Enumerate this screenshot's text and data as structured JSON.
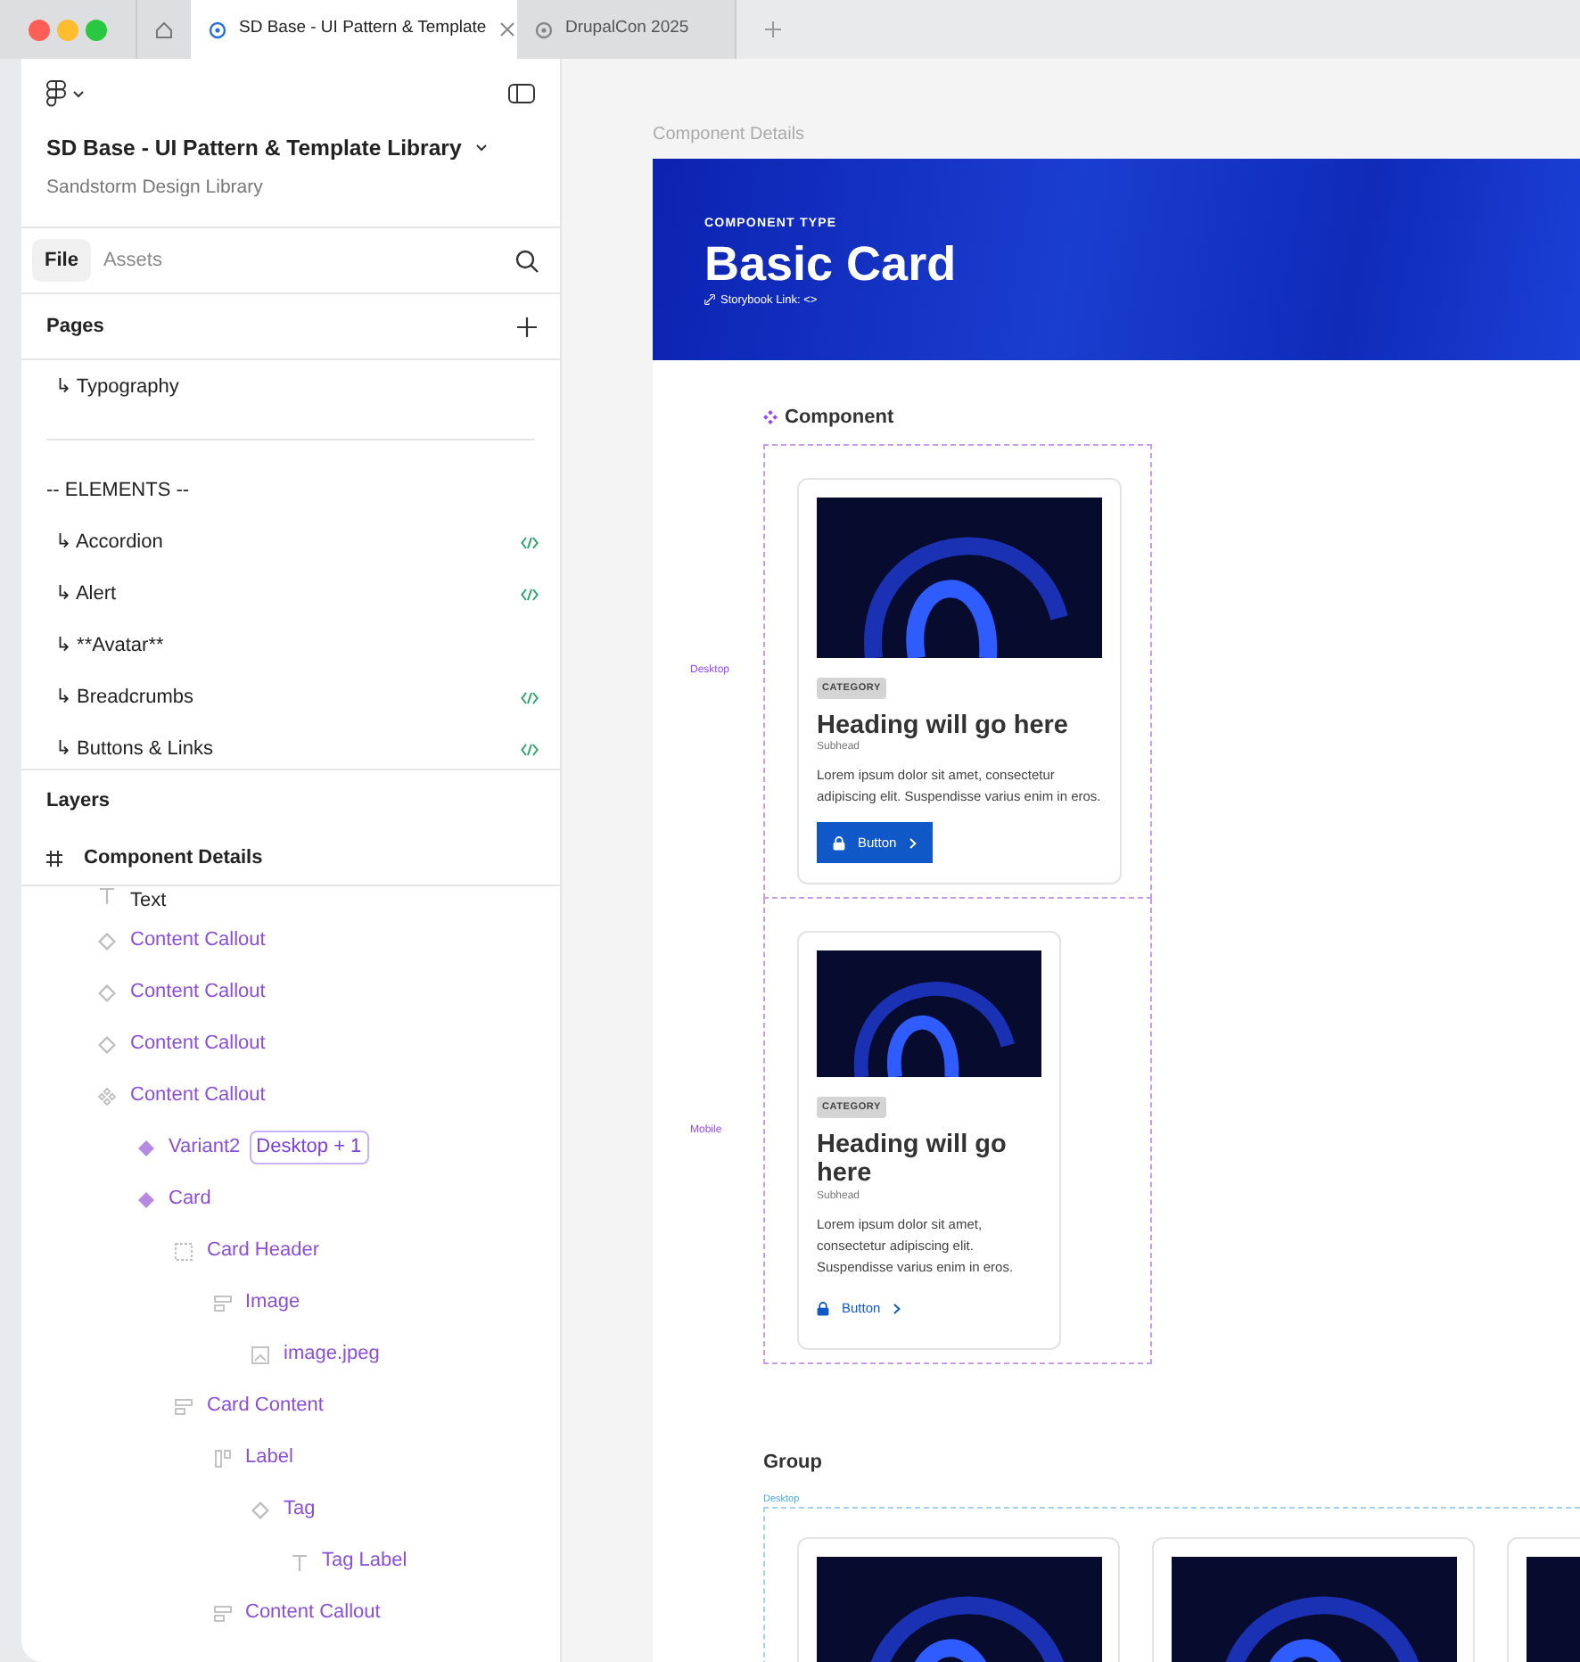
{
  "browser_tabs": [
    {
      "label": "SD Base - UI Pattern & Template",
      "selected": true
    },
    {
      "label": "DrupalCon 2025",
      "selected": false
    }
  ],
  "sidebar": {
    "file_title": "SD Base - UI Pattern & Template Library",
    "file_subtitle": "Sandstorm Design Library",
    "panel_tabs": [
      {
        "label": "File",
        "selected": true
      },
      {
        "label": "Assets",
        "selected": false
      }
    ],
    "pages": {
      "heading": "Pages",
      "items": [
        {
          "kind": "page",
          "label": "↳ Typography",
          "has_code": false
        },
        {
          "kind": "divider"
        },
        {
          "kind": "page",
          "label": "-- ELEMENTS --",
          "has_code": false
        },
        {
          "kind": "page",
          "label": "↳ Accordion",
          "has_code": true
        },
        {
          "kind": "page",
          "label": "↳ Alert",
          "has_code": true
        },
        {
          "kind": "page",
          "label": "↳ **Avatar**",
          "has_code": false
        },
        {
          "kind": "page",
          "label": "↳ Breadcrumbs",
          "has_code": true
        },
        {
          "kind": "page",
          "label": "↳ Buttons & Links",
          "has_code": true
        }
      ]
    },
    "layers": {
      "heading": "Layers",
      "frame_name": "Component Details",
      "items": [
        {
          "kind": "text",
          "label": "Text",
          "instance": false
        },
        {
          "kind": "instance",
          "label": "Content Callout",
          "instance": true
        },
        {
          "kind": "instance",
          "label": "Content Callout",
          "instance": true
        },
        {
          "kind": "instance",
          "label": "Content Callout",
          "instance": true
        },
        {
          "kind": "component-set",
          "label": "Content Callout",
          "instance": true,
          "children": [
            {
              "kind": "component",
              "label": "Variant2",
              "badge": "Desktop + 1",
              "instance": true
            },
            {
              "kind": "component",
              "label": "Card",
              "instance": true,
              "children": [
                {
                  "kind": "frame",
                  "label": "Card Header",
                  "instance": true,
                  "children": [
                    {
                      "kind": "autolayout-v",
                      "label": "Image",
                      "instance": true,
                      "children": [
                        {
                          "kind": "image",
                          "label": "image.jpeg",
                          "instance": true
                        }
                      ]
                    }
                  ]
                },
                {
                  "kind": "autolayout-v",
                  "label": "Card Content",
                  "instance": true,
                  "children": [
                    {
                      "kind": "autolayout-h",
                      "label": "Label",
                      "instance": true,
                      "children": [
                        {
                          "kind": "instance",
                          "label": "Tag",
                          "instance": true,
                          "children": [
                            {
                              "kind": "text",
                              "label": "Tag Label",
                              "instance": true
                            }
                          ]
                        }
                      ]
                    },
                    {
                      "kind": "autolayout-v",
                      "label": "Content Callout",
                      "instance": true
                    }
                  ]
                }
              ]
            }
          ]
        }
      ]
    }
  },
  "canvas": {
    "frame_label": "Component Details",
    "hero": {
      "eyebrow": "COMPONENT TYPE",
      "title": "Basic Card",
      "link": "Storybook Link: <>"
    },
    "component": {
      "heading": "Component",
      "variants": [
        {
          "label": "Desktop",
          "kind": "desktop",
          "card": {
            "category": "CATEGORY",
            "heading": "Heading will go here",
            "subhead": "Subhead",
            "body": "Lorem ipsum dolor sit amet, consectetur adipiscing elit. Suspendisse varius enim in eros.",
            "button": {
              "label": "Button",
              "kind": "filled"
            }
          }
        },
        {
          "label": "Mobile",
          "kind": "mobile",
          "card": {
            "category": "CATEGORY",
            "heading": "Heading will go here",
            "subhead": "Subhead",
            "body": "Lorem ipsum dolor sit amet, consectetur adipiscing elit. Suspendisse varius enim in eros.",
            "button": {
              "label": "Button",
              "kind": "text"
            }
          }
        }
      ]
    },
    "group": {
      "heading": "Group",
      "label": "Desktop",
      "cards": [
        {
          "kind": "image-card"
        },
        {
          "kind": "image-card"
        },
        {
          "kind": "image-card"
        }
      ]
    }
  }
}
